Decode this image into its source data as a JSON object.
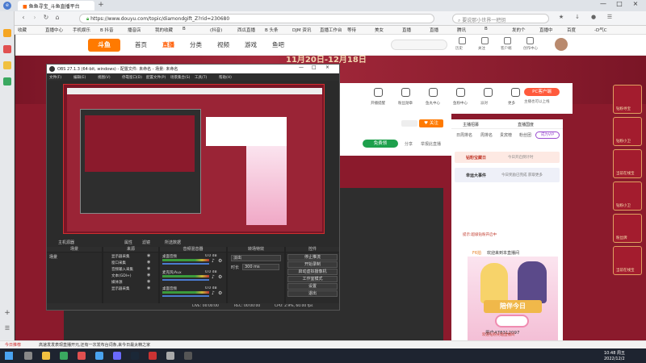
{
  "browser": {
    "tab_title": "鱼鱼寻宝_斗鱼直播平台",
    "url": "https://www.douyu.com/topic/diamondgift_Z?rid=230680",
    "search_placeholder": "要说那小世界一把钥",
    "bookmarks": [
      "收藏",
      "直播中心",
      "手机娱乐",
      "B 抖音",
      "播音店",
      "我的收藏",
      "B",
      "(抖音)",
      "西瓜直播",
      "B 头条",
      "DJM 资讯",
      "直播工作台",
      "等待",
      "美女",
      "直播",
      "直播",
      "腾讯",
      "B",
      "发的个",
      "直播中",
      "百度",
      "-D气C"
    ]
  },
  "douyu": {
    "logo": "斗鱼",
    "nav": [
      "首页",
      "直播",
      "分类",
      "视频",
      "游戏",
      "鱼吧"
    ],
    "banner_date": "11月20日-12月18日",
    "header_icons": [
      "历史",
      "关注",
      "客户端",
      "创作中心"
    ],
    "toolbar_icons": [
      "开播提醒",
      "粉丝勋章",
      "鱼丸中心",
      "鱼粉中心",
      "派对",
      "更多"
    ],
    "pc_button": "PC客户端",
    "pc_sub": "主播也可以上线",
    "follow_btn": "关注",
    "free_btn": "免费领",
    "share": "分享",
    "report": "举报此直播",
    "room_tabs": [
      "主播招募",
      "直播国度"
    ],
    "rank_tabs": [
      "日周排名",
      "周排名",
      "贵宾榜",
      "粉丝团"
    ],
    "buy_btn": "成为VIP",
    "chest_text": "钻粉宝藏日",
    "chest_sub": "今日开启倒计时",
    "event_text": "幸运大事件",
    "event_sub": "今日奖励已完成 获取更多",
    "chat_text": "欢迎来到本直播间",
    "chat_user": "F6拍",
    "gift_text": "提示:超级钻粉开启中",
    "poster_title": "陪伴今日",
    "poster_user": "用户478312097",
    "poster_sub": "欢迎钻粉光临直播间",
    "side_badges": [
      "钻粉寻宝",
      "钻粉小卫",
      "当前在线宝",
      "钻粉小卫",
      "粉丝牌",
      "当前在线宝"
    ]
  },
  "obs": {
    "title": "OBS 27.1.3 (64-bit, windows) - 配置文件: 未命名 - 场景: 未命名",
    "menu": [
      "文件(F)",
      "编辑(E)",
      "视图(V)",
      "停靠窗口(D)",
      "配置文件(P)",
      "场景集合(S)",
      "工具(T)",
      "帮助(H)"
    ],
    "source_label": "主机源器",
    "props_btn": "属性",
    "filters_btn": "滤镜",
    "capture_btn": "所选数据",
    "docks": [
      "场景",
      "来源",
      "音频混音器",
      "转场特效",
      "控件"
    ],
    "scene_item": "场景",
    "sources": [
      "显示器采集",
      "窗口采集",
      "音频输入采集",
      "文本(GDI+)",
      "媒体源",
      "显示器采集"
    ],
    "mixer": [
      {
        "name": "桌面音频",
        "db": "0.0 dB"
      },
      {
        "name": "麦克风/Aux",
        "db": "0.0 dB"
      },
      {
        "name": "桌面音频",
        "db": "0.0 dB"
      }
    ],
    "transition": "淡出",
    "duration_label": "时长",
    "duration": "300 ms",
    "controls": [
      "停止推流",
      "开始录制",
      "启动虚拟摄像机",
      "工作室模式",
      "设置",
      "退出"
    ],
    "status": [
      "LIVE: 00:00:00",
      "REC: 00:00:00",
      "CPU: 2.9%, 60.00 fps"
    ]
  },
  "taskbar": {
    "time": "10:48 周五",
    "date": "2022/12/2",
    "notice": "今日推荐",
    "notice_text": "高速发发表现直播开元,还有一次发布台词条,来今日最太精之家"
  }
}
